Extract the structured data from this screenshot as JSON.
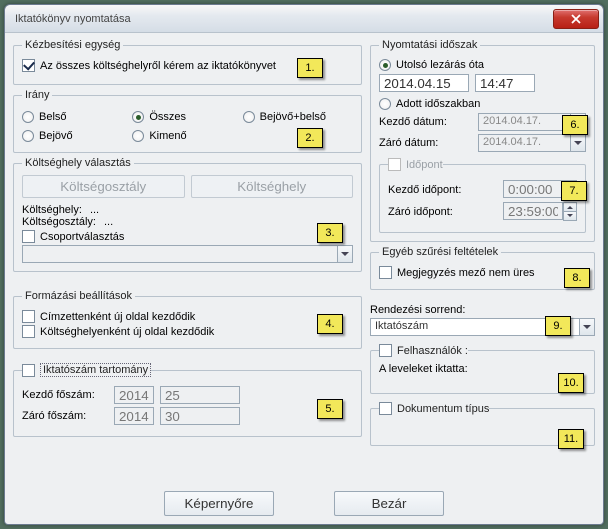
{
  "title": "Iktatókönyv nyomtatása",
  "delivery": {
    "legend": "Kézbesítési egység",
    "all_costplaces": "Az összes költséghelyről kérem az iktatókönyvet"
  },
  "direction": {
    "legend": "Irány",
    "belso": "Belső",
    "osszes": "Összes",
    "bejovo_belso": "Bejövő+belső",
    "bejovo": "Bejövő",
    "kimeno": "Kimenő"
  },
  "costplace_sel": {
    "legend": "Költséghely választás",
    "btn_class": "Költségosztály",
    "btn_place": "Költséghely",
    "lbl_place": "Költséghely:",
    "lbl_place_val": "...",
    "lbl_class": "Költségosztály:",
    "lbl_class_val": "...",
    "chk_group": "Csoportválasztás"
  },
  "format": {
    "legend": "Formázási beállítások",
    "by_addressee": "Címzettenként új oldal kezdődik",
    "by_costplace": "Költséghelyenként új oldal kezdődik"
  },
  "range": {
    "chk": "Iktatószám tartomány",
    "start_lbl": "Kezdő főszám:",
    "start_year": "2014",
    "start_no": "25",
    "end_lbl": "Záró főszám:",
    "end_year": "2014",
    "end_no": "30"
  },
  "period": {
    "legend": "Nyomtatási időszak",
    "last_close": "Utolsó lezárás óta",
    "date_val": "2014.04.15",
    "time_val": "14:47",
    "given_period": "Adott időszakban",
    "start_date_lbl": "Kezdő dátum:",
    "start_date_val": "2014.04.17.",
    "end_date_lbl": "Záró dátum:",
    "end_date_val": "2014.04.17.",
    "time_legend": "Időpont",
    "start_time_lbl": "Kezdő időpont:",
    "start_time_val": "0:00:00",
    "end_time_lbl": "Záró időpont:",
    "end_time_val": "23:59:00"
  },
  "other": {
    "legend": "Egyéb szűrési feltételek",
    "comment_nonempty": "Megjegyzés mező nem üres"
  },
  "sort": {
    "label": "Rendezési sorrend:",
    "value": "Iktatószám"
  },
  "users": {
    "legend": "Felhasználók :",
    "caption": "A leveleket iktatta:"
  },
  "doctype": {
    "legend": "Dokumentum típus"
  },
  "footer": {
    "screen": "Képernyőre",
    "close": "Bezár"
  },
  "notes": {
    "n1": "1.",
    "n2": "2.",
    "n3": "3.",
    "n4": "4.",
    "n5": "5.",
    "n6": "6.",
    "n7": "7.",
    "n8": "8.",
    "n9": "9.",
    "n10": "10.",
    "n11": "11."
  }
}
